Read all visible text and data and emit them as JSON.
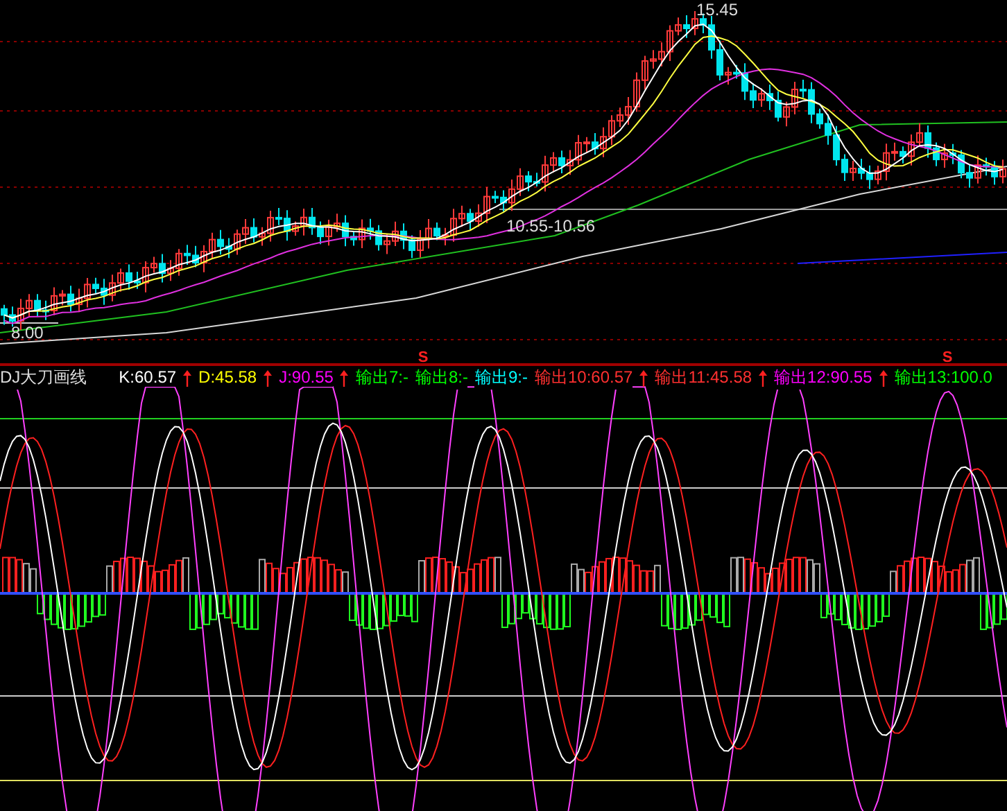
{
  "main_chart": {
    "labels": [
      {
        "kind": "high",
        "text": "15.45"
      },
      {
        "kind": "range",
        "text": "10.55-10.56"
      },
      {
        "kind": "low",
        "text": "8.00"
      }
    ]
  },
  "signal_marks": [
    {
      "text": "S"
    },
    {
      "text": "S"
    }
  ],
  "indicator": {
    "title": "DJ大刀画线",
    "values": [
      {
        "text": "K:60.57",
        "color": "#ffffff",
        "arrow": true
      },
      {
        "text": "D:45.58",
        "color": "#ffff00",
        "arrow": true
      },
      {
        "text": "J:90.55",
        "color": "#ff00ff",
        "arrow": true
      },
      {
        "text": "输出7:-",
        "color": "#00ff00",
        "arrow": false
      },
      {
        "text": "输出8:-",
        "color": "#00ff00",
        "arrow": false
      },
      {
        "text": "输出9:-",
        "color": "#00ffff",
        "arrow": false
      },
      {
        "text": "输出10:60.57",
        "color": "#ff3030",
        "arrow": true
      },
      {
        "text": "输出11:45.58",
        "color": "#ff3030",
        "arrow": true
      },
      {
        "text": "输出12:90.55",
        "color": "#ff00ff",
        "arrow": true
      },
      {
        "text": "输出13:100.0",
        "color": "#00ff00",
        "arrow": false
      }
    ]
  }
}
